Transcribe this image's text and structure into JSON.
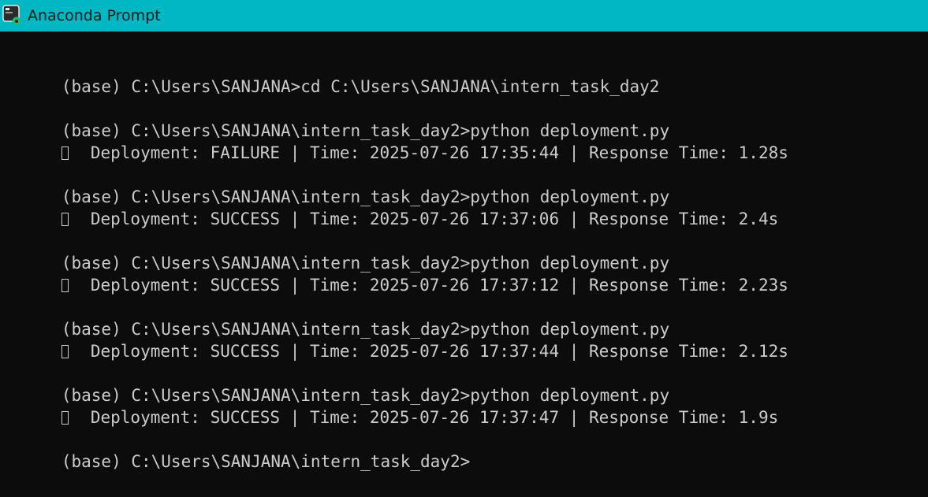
{
  "window": {
    "title": "Anaconda Prompt",
    "titlebar_color": "#00b7c3",
    "background_color": "#0c0c0c",
    "text_color": "#cccccc"
  },
  "console": {
    "lines": [
      {
        "type": "prompt",
        "text": "(base) C:\\Users\\SANJANA>cd C:\\Users\\SANJANA\\intern_task_day2"
      },
      {
        "type": "prompt",
        "text": "(base) C:\\Users\\SANJANA\\intern_task_day2>python deployment.py"
      },
      {
        "type": "output",
        "icon": "missing-glyph-icon",
        "text": "Deployment: FAILURE | Time: 2025-07-26 17:35:44 | Response Time: 1.28s"
      },
      {
        "type": "prompt",
        "text": "(base) C:\\Users\\SANJANA\\intern_task_day2>python deployment.py"
      },
      {
        "type": "output",
        "icon": "missing-glyph-icon",
        "text": "Deployment: SUCCESS | Time: 2025-07-26 17:37:06 | Response Time: 2.4s"
      },
      {
        "type": "prompt",
        "text": "(base) C:\\Users\\SANJANA\\intern_task_day2>python deployment.py"
      },
      {
        "type": "output",
        "icon": "missing-glyph-icon",
        "text": "Deployment: SUCCESS | Time: 2025-07-26 17:37:12 | Response Time: 2.23s"
      },
      {
        "type": "prompt",
        "text": "(base) C:\\Users\\SANJANA\\intern_task_day2>python deployment.py"
      },
      {
        "type": "output",
        "icon": "missing-glyph-icon",
        "text": "Deployment: SUCCESS | Time: 2025-07-26 17:37:44 | Response Time: 2.12s"
      },
      {
        "type": "prompt",
        "text": "(base) C:\\Users\\SANJANA\\intern_task_day2>python deployment.py"
      },
      {
        "type": "output",
        "icon": "missing-glyph-icon",
        "text": "Deployment: SUCCESS | Time: 2025-07-26 17:37:47 | Response Time: 1.9s"
      },
      {
        "type": "prompt",
        "text": "(base) C:\\Users\\SANJANA\\intern_task_day2>"
      }
    ]
  }
}
